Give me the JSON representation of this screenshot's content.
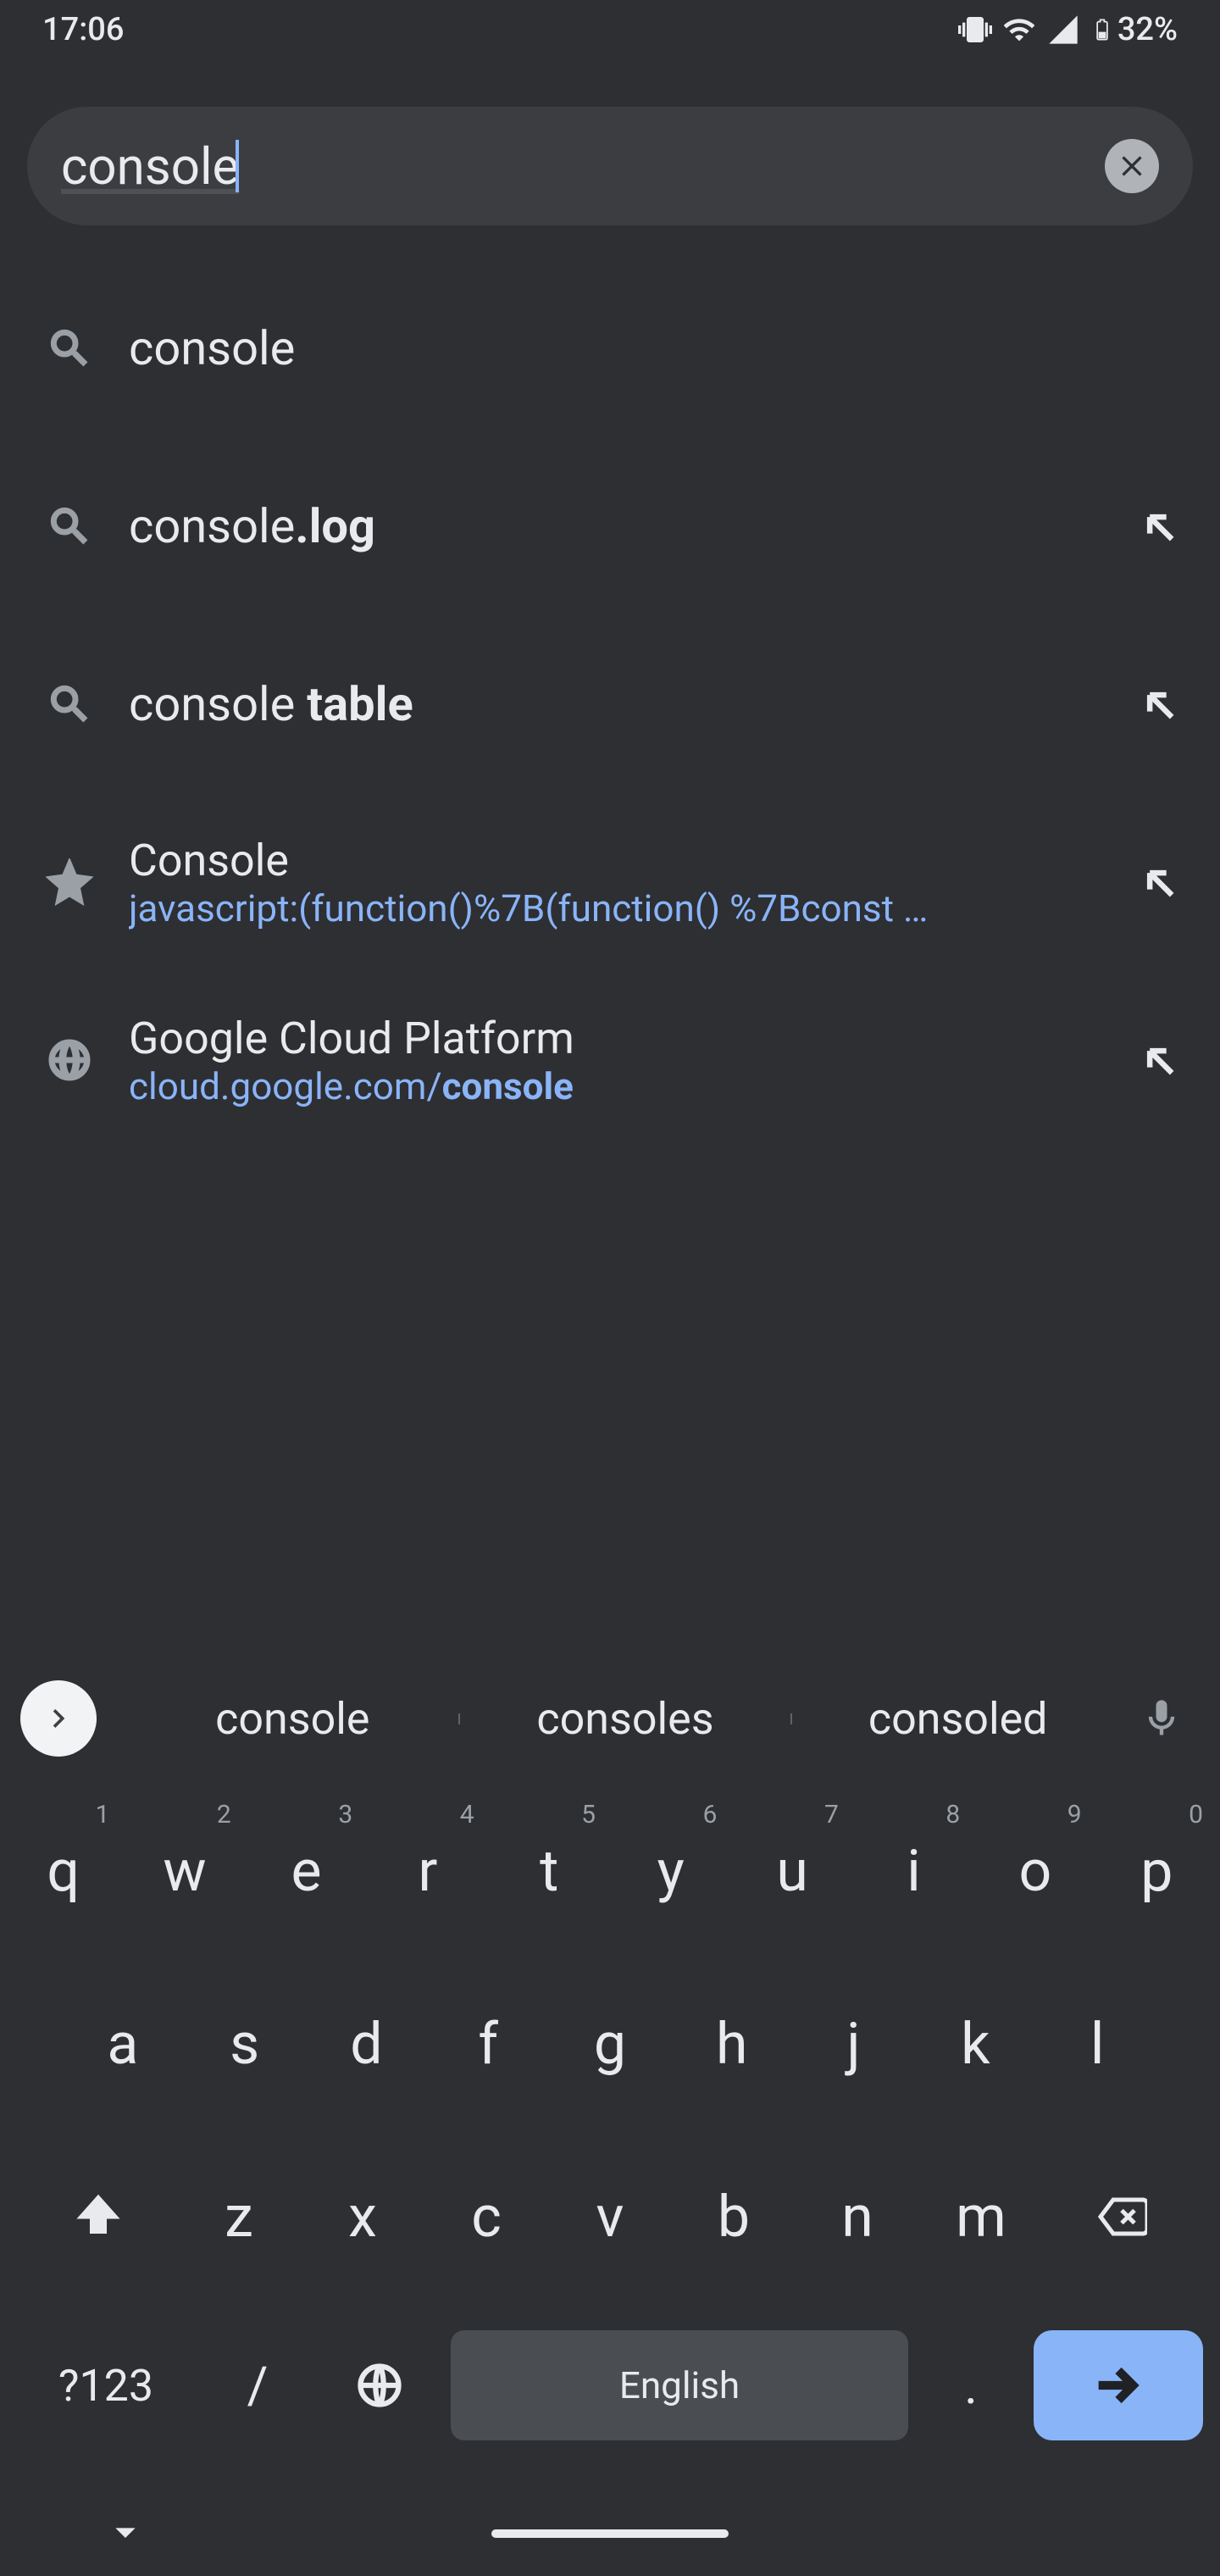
{
  "status": {
    "time": "17:06",
    "battery_pct": "32%"
  },
  "search": {
    "value": "console"
  },
  "suggestions": [
    {
      "kind": "query",
      "prefix": "console",
      "bold": "",
      "has_refine": false
    },
    {
      "kind": "query",
      "prefix": "console",
      "bold": ".log",
      "has_refine": true
    },
    {
      "kind": "query",
      "prefix": "console ",
      "bold": "table",
      "has_refine": true
    },
    {
      "kind": "bookmark",
      "title": "Console",
      "url_display": "javascript:(function()%7B(function() %7Bconst …",
      "has_refine": true
    },
    {
      "kind": "site",
      "title": "Google Cloud Platform",
      "url_prefix": "cloud.google.com/",
      "url_bold": "console",
      "has_refine": true
    }
  ],
  "word_bar": {
    "candidates": [
      "console",
      "consoles",
      "consoled"
    ],
    "language": "English",
    "sym_label": "?123",
    "slash": "/",
    "dot": "."
  },
  "keyboard": {
    "row1": [
      {
        "l": "q",
        "h": "1"
      },
      {
        "l": "w",
        "h": "2"
      },
      {
        "l": "e",
        "h": "3"
      },
      {
        "l": "r",
        "h": "4"
      },
      {
        "l": "t",
        "h": "5"
      },
      {
        "l": "y",
        "h": "6"
      },
      {
        "l": "u",
        "h": "7"
      },
      {
        "l": "i",
        "h": "8"
      },
      {
        "l": "o",
        "h": "9"
      },
      {
        "l": "p",
        "h": "0"
      }
    ],
    "row2": [
      "a",
      "s",
      "d",
      "f",
      "g",
      "h",
      "j",
      "k",
      "l"
    ],
    "row3": [
      "z",
      "x",
      "c",
      "v",
      "b",
      "n",
      "m"
    ]
  },
  "colors": {
    "accent": "#8ab4f8",
    "bg": "#2e2f33",
    "field": "#3c3d41"
  }
}
